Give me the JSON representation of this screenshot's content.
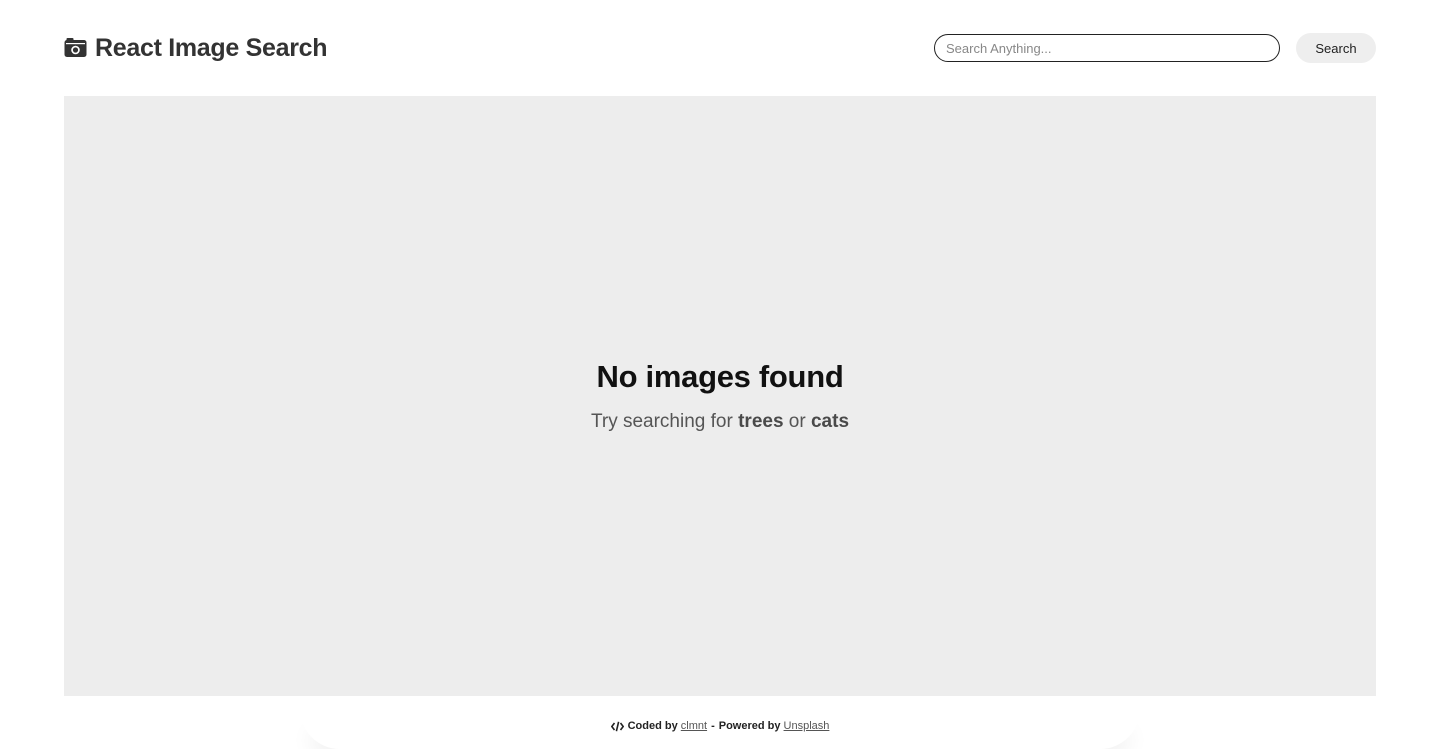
{
  "header": {
    "logo_icon": "camera-icon",
    "title": "React Image Search"
  },
  "search": {
    "placeholder": "Search Anything...",
    "value": "",
    "button_label": "Search"
  },
  "results": {
    "empty_title": "No images found",
    "hint_prefix": "Try searching for",
    "hint_term_1": "trees",
    "hint_join": "or",
    "hint_term_2": "cats"
  },
  "footer": {
    "icon": "code-icon",
    "coded_by_label": "Coded by",
    "author_link": "clmnt",
    "separator": "-",
    "powered_by_label": "Powered by",
    "provider_link": "Unsplash"
  }
}
